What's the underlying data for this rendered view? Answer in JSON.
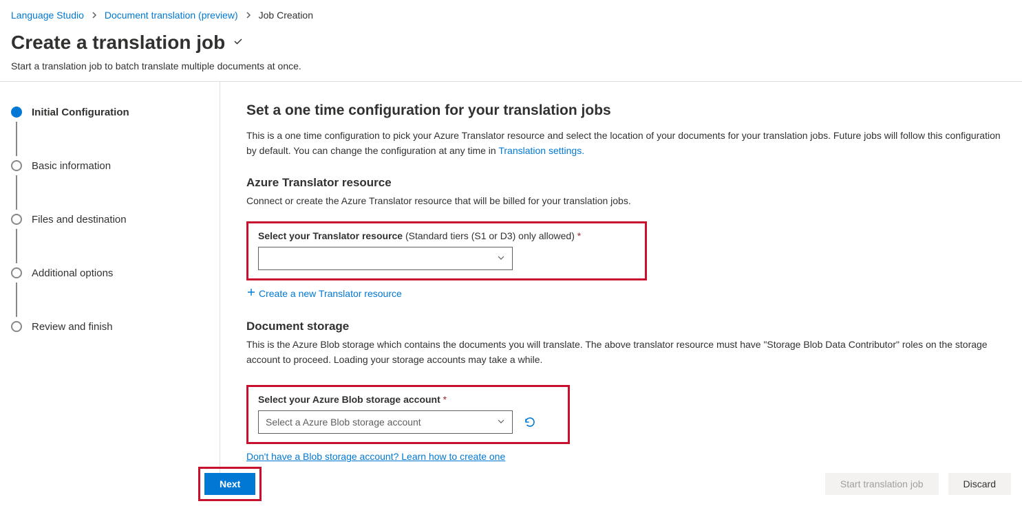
{
  "breadcrumb": {
    "items": [
      {
        "label": "Language Studio",
        "link": true
      },
      {
        "label": "Document translation (preview)",
        "link": true
      },
      {
        "label": "Job Creation",
        "link": false
      }
    ]
  },
  "header": {
    "title": "Create a translation job",
    "subtitle": "Start a translation job to batch translate multiple documents at once."
  },
  "steps": [
    {
      "label": "Initial Configuration",
      "active": true
    },
    {
      "label": "Basic information",
      "active": false
    },
    {
      "label": "Files and destination",
      "active": false
    },
    {
      "label": "Additional options",
      "active": false
    },
    {
      "label": "Review and finish",
      "active": false
    }
  ],
  "main": {
    "heading": "Set a one time configuration for your translation jobs",
    "desc_part1": "This is a one time configuration to pick your Azure Translator resource and select the location of your documents for your translation jobs. Future jobs will follow this configuration by default. You can change the configuration at any time in ",
    "desc_link": "Translation settings.",
    "translator": {
      "title": "Azure Translator resource",
      "desc": "Connect or create the Azure Translator resource that will be billed for your translation jobs.",
      "field_label_bold": "Select your Translator resource",
      "field_label_rest": " (Standard tiers (S1 or D3) only allowed)",
      "dropdown_value": "",
      "create_link": "Create a new Translator resource"
    },
    "storage": {
      "title": "Document storage",
      "desc": "This is the Azure Blob storage which contains the documents you will translate. The above translator resource must have \"Storage Blob Data Contributor\" roles on the storage account to proceed. Loading your storage accounts may take a while.",
      "field_label_bold": "Select your Azure Blob storage account",
      "dropdown_placeholder": "Select a Azure Blob storage account",
      "help_link": "Don't have a Blob storage account? Learn how to create one"
    }
  },
  "footer": {
    "next": "Next",
    "start": "Start translation job",
    "discard": "Discard"
  }
}
